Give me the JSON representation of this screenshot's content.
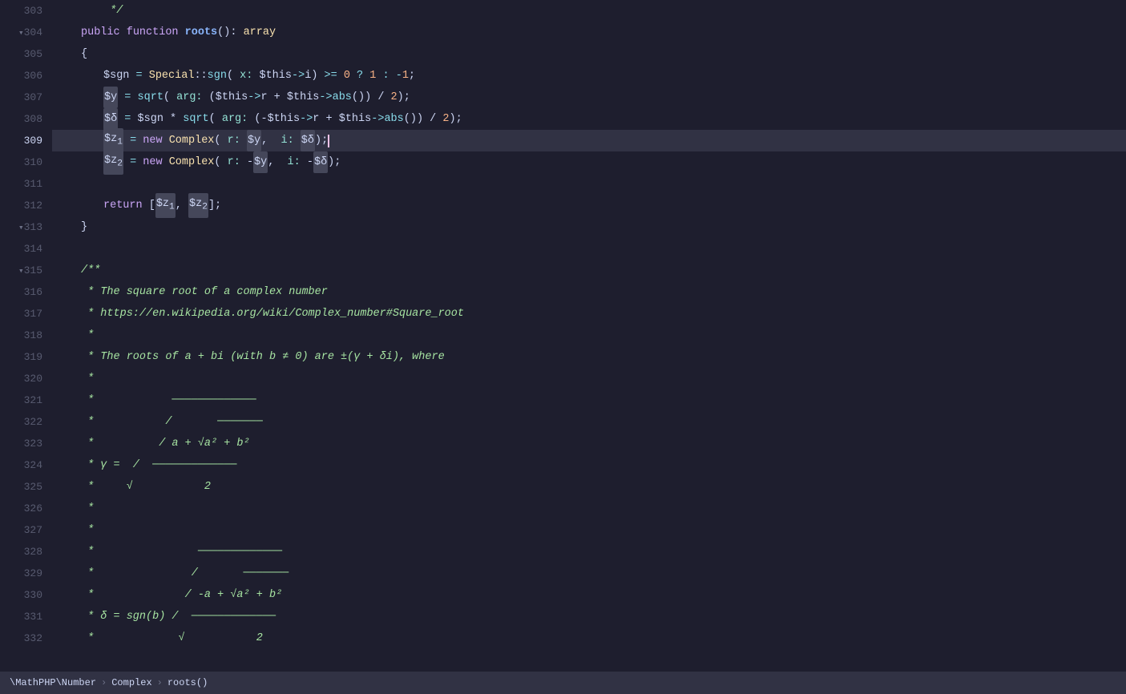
{
  "editor": {
    "lines": [
      {
        "num": 303,
        "fold": null,
        "content": "comment_end",
        "active": false
      },
      {
        "num": 304,
        "fold": "collapse",
        "content": "function_sig",
        "active": false
      },
      {
        "num": 305,
        "fold": null,
        "content": "brace_open",
        "active": false
      },
      {
        "num": 306,
        "fold": null,
        "content": "line_sgn",
        "active": false
      },
      {
        "num": 307,
        "fold": null,
        "content": "line_y",
        "active": false
      },
      {
        "num": 308,
        "fold": null,
        "content": "line_delta",
        "active": false
      },
      {
        "num": 309,
        "fold": null,
        "content": "line_z1",
        "active": true,
        "highlighted": true
      },
      {
        "num": 310,
        "fold": null,
        "content": "line_z2",
        "active": false
      },
      {
        "num": 311,
        "fold": null,
        "content": "empty",
        "active": false
      },
      {
        "num": 312,
        "fold": null,
        "content": "line_return",
        "active": false
      },
      {
        "num": 313,
        "fold": "collapse",
        "content": "brace_close",
        "active": false
      },
      {
        "num": 314,
        "fold": null,
        "content": "empty",
        "active": false
      },
      {
        "num": 315,
        "fold": "collapse",
        "content": "doc_start",
        "active": false
      },
      {
        "num": 316,
        "fold": null,
        "content": "doc_square_root",
        "active": false
      },
      {
        "num": 317,
        "fold": null,
        "content": "doc_link",
        "active": false
      },
      {
        "num": 318,
        "fold": null,
        "content": "doc_star",
        "active": false
      },
      {
        "num": 319,
        "fold": null,
        "content": "doc_roots",
        "active": false
      },
      {
        "num": 320,
        "fold": null,
        "content": "doc_star",
        "active": false
      },
      {
        "num": 321,
        "fold": null,
        "content": "doc_line1",
        "active": false
      },
      {
        "num": 322,
        "fold": null,
        "content": "doc_line2",
        "active": false
      },
      {
        "num": 323,
        "fold": null,
        "content": "doc_line3",
        "active": false
      },
      {
        "num": 324,
        "fold": null,
        "content": "doc_gamma",
        "active": false
      },
      {
        "num": 325,
        "fold": null,
        "content": "doc_sqrt2",
        "active": false
      },
      {
        "num": 326,
        "fold": null,
        "content": "doc_star",
        "active": false
      },
      {
        "num": 327,
        "fold": null,
        "content": "doc_star",
        "active": false
      },
      {
        "num": 328,
        "fold": null,
        "content": "doc_line4",
        "active": false
      },
      {
        "num": 329,
        "fold": null,
        "content": "doc_line5",
        "active": false
      },
      {
        "num": 330,
        "fold": null,
        "content": "doc_delta_line",
        "active": false
      },
      {
        "num": 331,
        "fold": null,
        "content": "doc_sqrt2b",
        "active": false
      },
      {
        "num": 332,
        "fold": null,
        "content": "doc_star2",
        "active": false
      }
    ],
    "status": {
      "path": "\\MathPHP\\Number",
      "breadcrumb1": "\\MathPHP\\Number",
      "breadcrumb2": "Complex",
      "breadcrumb3": "roots()"
    }
  }
}
